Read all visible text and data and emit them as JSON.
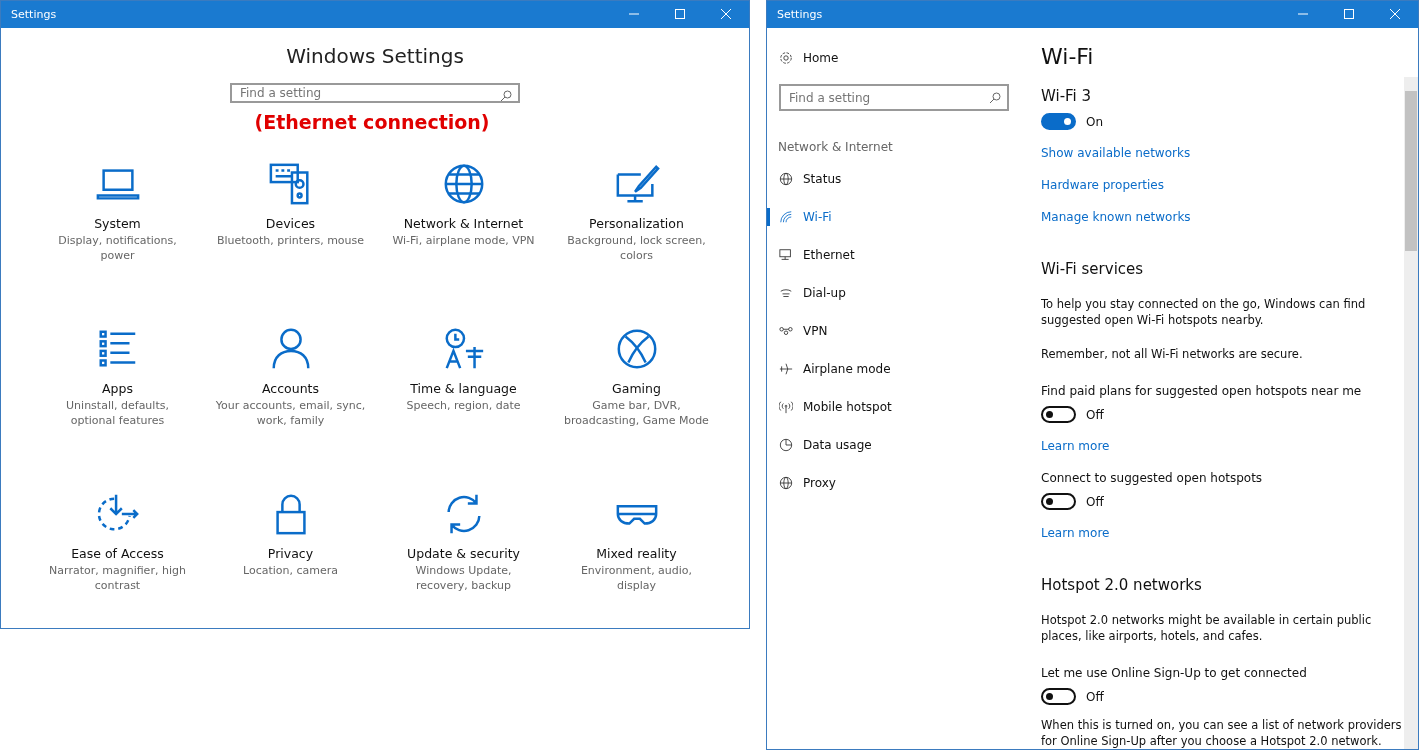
{
  "settings_window": {
    "title": "Settings",
    "heading": "Windows Settings",
    "search": {
      "placeholder": "Find a setting"
    },
    "annotation": "(Ethernet connection)",
    "categories": [
      {
        "name": "System",
        "description": "Display, notifications, power"
      },
      {
        "name": "Devices",
        "description": "Bluetooth, printers, mouse"
      },
      {
        "name": "Network & Internet",
        "description": "Wi-Fi, airplane mode, VPN"
      },
      {
        "name": "Personalization",
        "description": "Background, lock screen, colors"
      },
      {
        "name": "Apps",
        "description": "Uninstall, defaults, optional features"
      },
      {
        "name": "Accounts",
        "description": "Your accounts, email, sync, work, family"
      },
      {
        "name": "Time & language",
        "description": "Speech, region, date"
      },
      {
        "name": "Gaming",
        "description": "Game bar, DVR, broadcasting, Game Mode"
      },
      {
        "name": "Ease of Access",
        "description": "Narrator, magnifier, high contrast"
      },
      {
        "name": "Privacy",
        "description": "Location, camera"
      },
      {
        "name": "Update & security",
        "description": "Windows Update, recovery, backup"
      },
      {
        "name": "Mixed reality",
        "description": "Environment, audio, display"
      }
    ]
  },
  "wifi_window": {
    "title": "Settings",
    "sidebar": {
      "home": "Home",
      "search": {
        "placeholder": "Find a setting"
      },
      "section": "Network & Internet",
      "items": [
        {
          "label": "Status",
          "selected": false
        },
        {
          "label": "Wi-Fi",
          "selected": true
        },
        {
          "label": "Ethernet",
          "selected": false
        },
        {
          "label": "Dial-up",
          "selected": false
        },
        {
          "label": "VPN",
          "selected": false
        },
        {
          "label": "Airplane mode",
          "selected": false
        },
        {
          "label": "Mobile hotspot",
          "selected": false
        },
        {
          "label": "Data usage",
          "selected": false
        },
        {
          "label": "Proxy",
          "selected": false
        }
      ]
    },
    "content": [
      {
        "kind": "title",
        "text": "Wi-Fi"
      },
      {
        "kind": "subtitle",
        "text": "Wi-Fi 3"
      },
      {
        "kind": "toggle",
        "on": true,
        "text": "On"
      },
      {
        "kind": "link",
        "text": "Show available networks"
      },
      {
        "kind": "link",
        "text": "Hardware properties"
      },
      {
        "kind": "link",
        "text": "Manage known networks"
      },
      {
        "kind": "heading",
        "text": "Wi-Fi services"
      },
      {
        "kind": "paragraph",
        "text": "To help you stay connected on the go, Windows can find suggested open Wi-Fi hotspots nearby."
      },
      {
        "kind": "paragraph",
        "text": "Remember, not all Wi-Fi networks are secure."
      },
      {
        "kind": "label",
        "text": "Find paid plans for suggested open hotspots near me"
      },
      {
        "kind": "toggle",
        "on": false,
        "text": "Off"
      },
      {
        "kind": "link",
        "text": "Learn more"
      },
      {
        "kind": "label",
        "text": "Connect to suggested open hotspots"
      },
      {
        "kind": "toggle",
        "on": false,
        "text": "Off"
      },
      {
        "kind": "link",
        "text": "Learn more"
      },
      {
        "kind": "heading",
        "text": "Hotspot 2.0 networks"
      },
      {
        "kind": "paragraph",
        "text": "Hotspot 2.0 networks might be available in certain public places, like airports, hotels, and cafes."
      },
      {
        "kind": "label",
        "text": "Let me use Online Sign-Up to get connected"
      },
      {
        "kind": "toggle",
        "on": false,
        "text": "Off"
      },
      {
        "kind": "paragraph",
        "text": "When this is turned on, you can see a list of network providers for Online Sign-Up after you choose a Hotspot 2.0 network."
      }
    ]
  }
}
